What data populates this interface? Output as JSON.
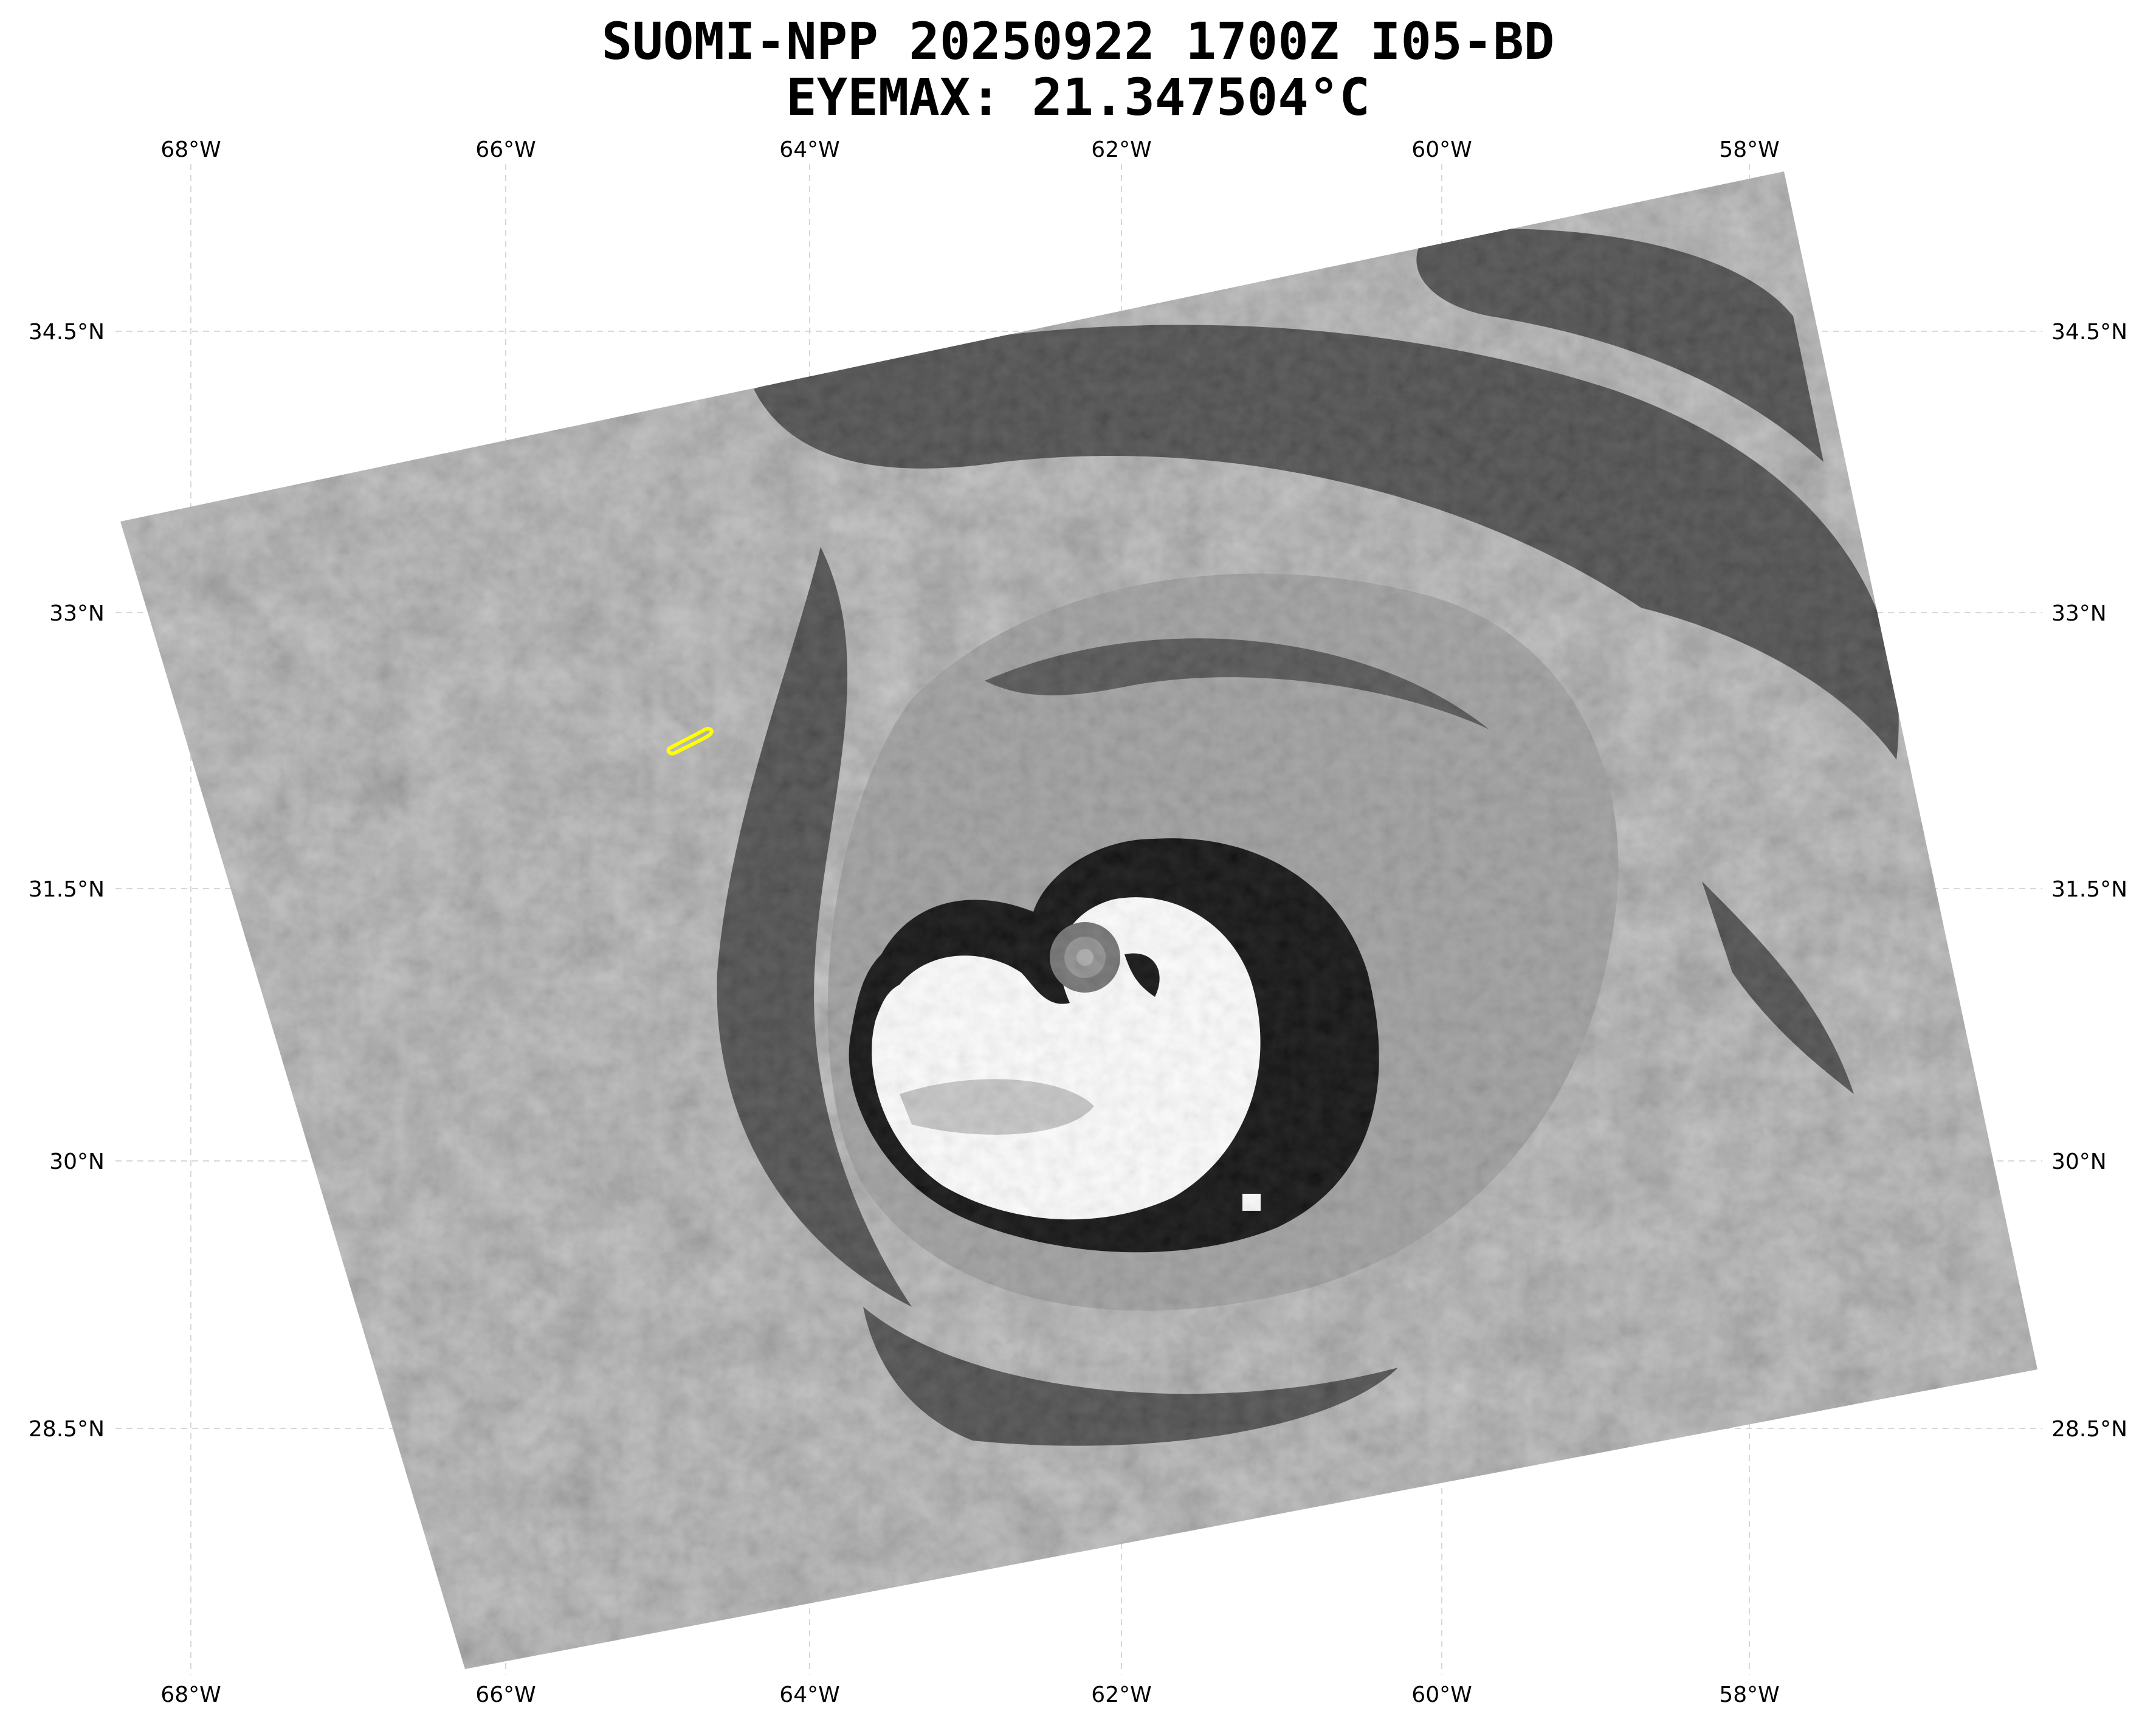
{
  "title": {
    "line1": "SUOMI-NPP 20250922 1700Z I05-BD",
    "line2": "EYEMAX: 21.347504°C"
  },
  "axes": {
    "longitude_ticks": [
      "68°W",
      "66°W",
      "64°W",
      "62°W",
      "60°W",
      "58°W"
    ],
    "latitude_ticks": [
      "34.5°N",
      "33°N",
      "31.5°N",
      "30°N",
      "28.5°N"
    ]
  },
  "image": {
    "subject": "hurricane-infrared-satellite-swath",
    "colors": {
      "background": "#ffffff",
      "grid": "#d8d8d8",
      "swath_base": "#8e8e8e",
      "cold_ring": "#000000",
      "coldest_tops": "#ffffff",
      "band_dark": "#3e3e3e",
      "band_mid": "#9a9a9a",
      "coastline": "#ffff00"
    }
  }
}
